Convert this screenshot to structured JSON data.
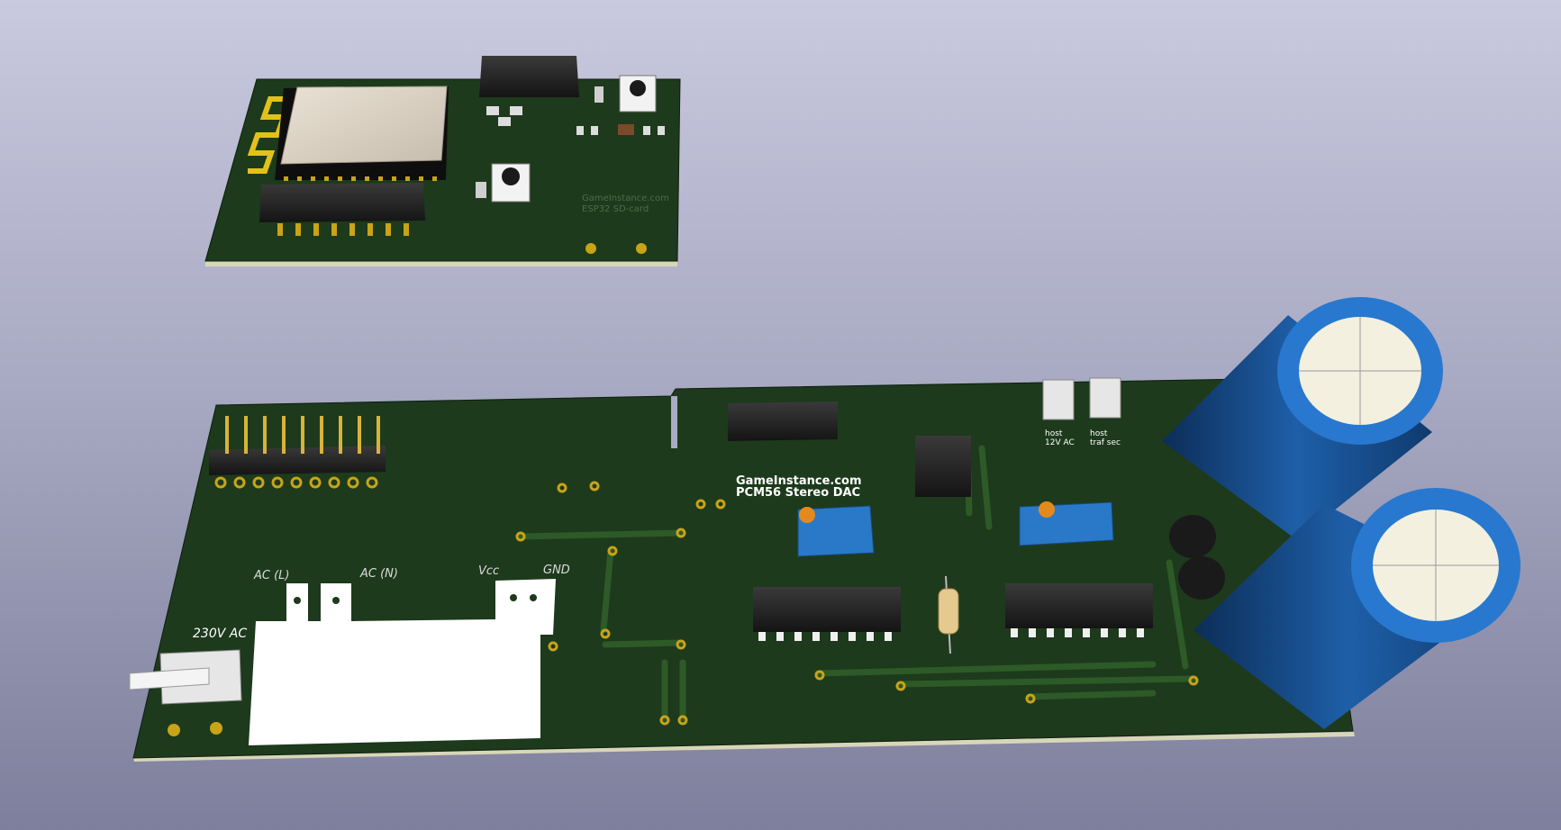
{
  "viewer": {
    "title": ""
  },
  "colors": {
    "background_top": "#c9c9df",
    "background_bottom": "#7e7f9c",
    "pcb_green": "#1d3a1c",
    "pcb_edge": "#d8d6b8",
    "copper_pad": "#c9a318",
    "silkscreen": "#ffffff",
    "capacitor_blue": "#1e5fa8"
  },
  "boards": {
    "esp32": {
      "silk_line_1": "GameInstance.com",
      "silk_line_2": "ESP32 SD-card"
    },
    "dac": {
      "title_line_1": "GameInstance.com",
      "title_line_2": "PCM56 Stereo DAC",
      "label_ac_l": "AC (L)",
      "label_ac_n": "AC (N)",
      "label_vcc": "Vcc",
      "label_gnd": "GND",
      "label_230v": "230V AC",
      "label_host_1a": "host",
      "label_host_1b": "12V AC",
      "label_host_2a": "host",
      "label_host_2b": "traf sec"
    }
  }
}
